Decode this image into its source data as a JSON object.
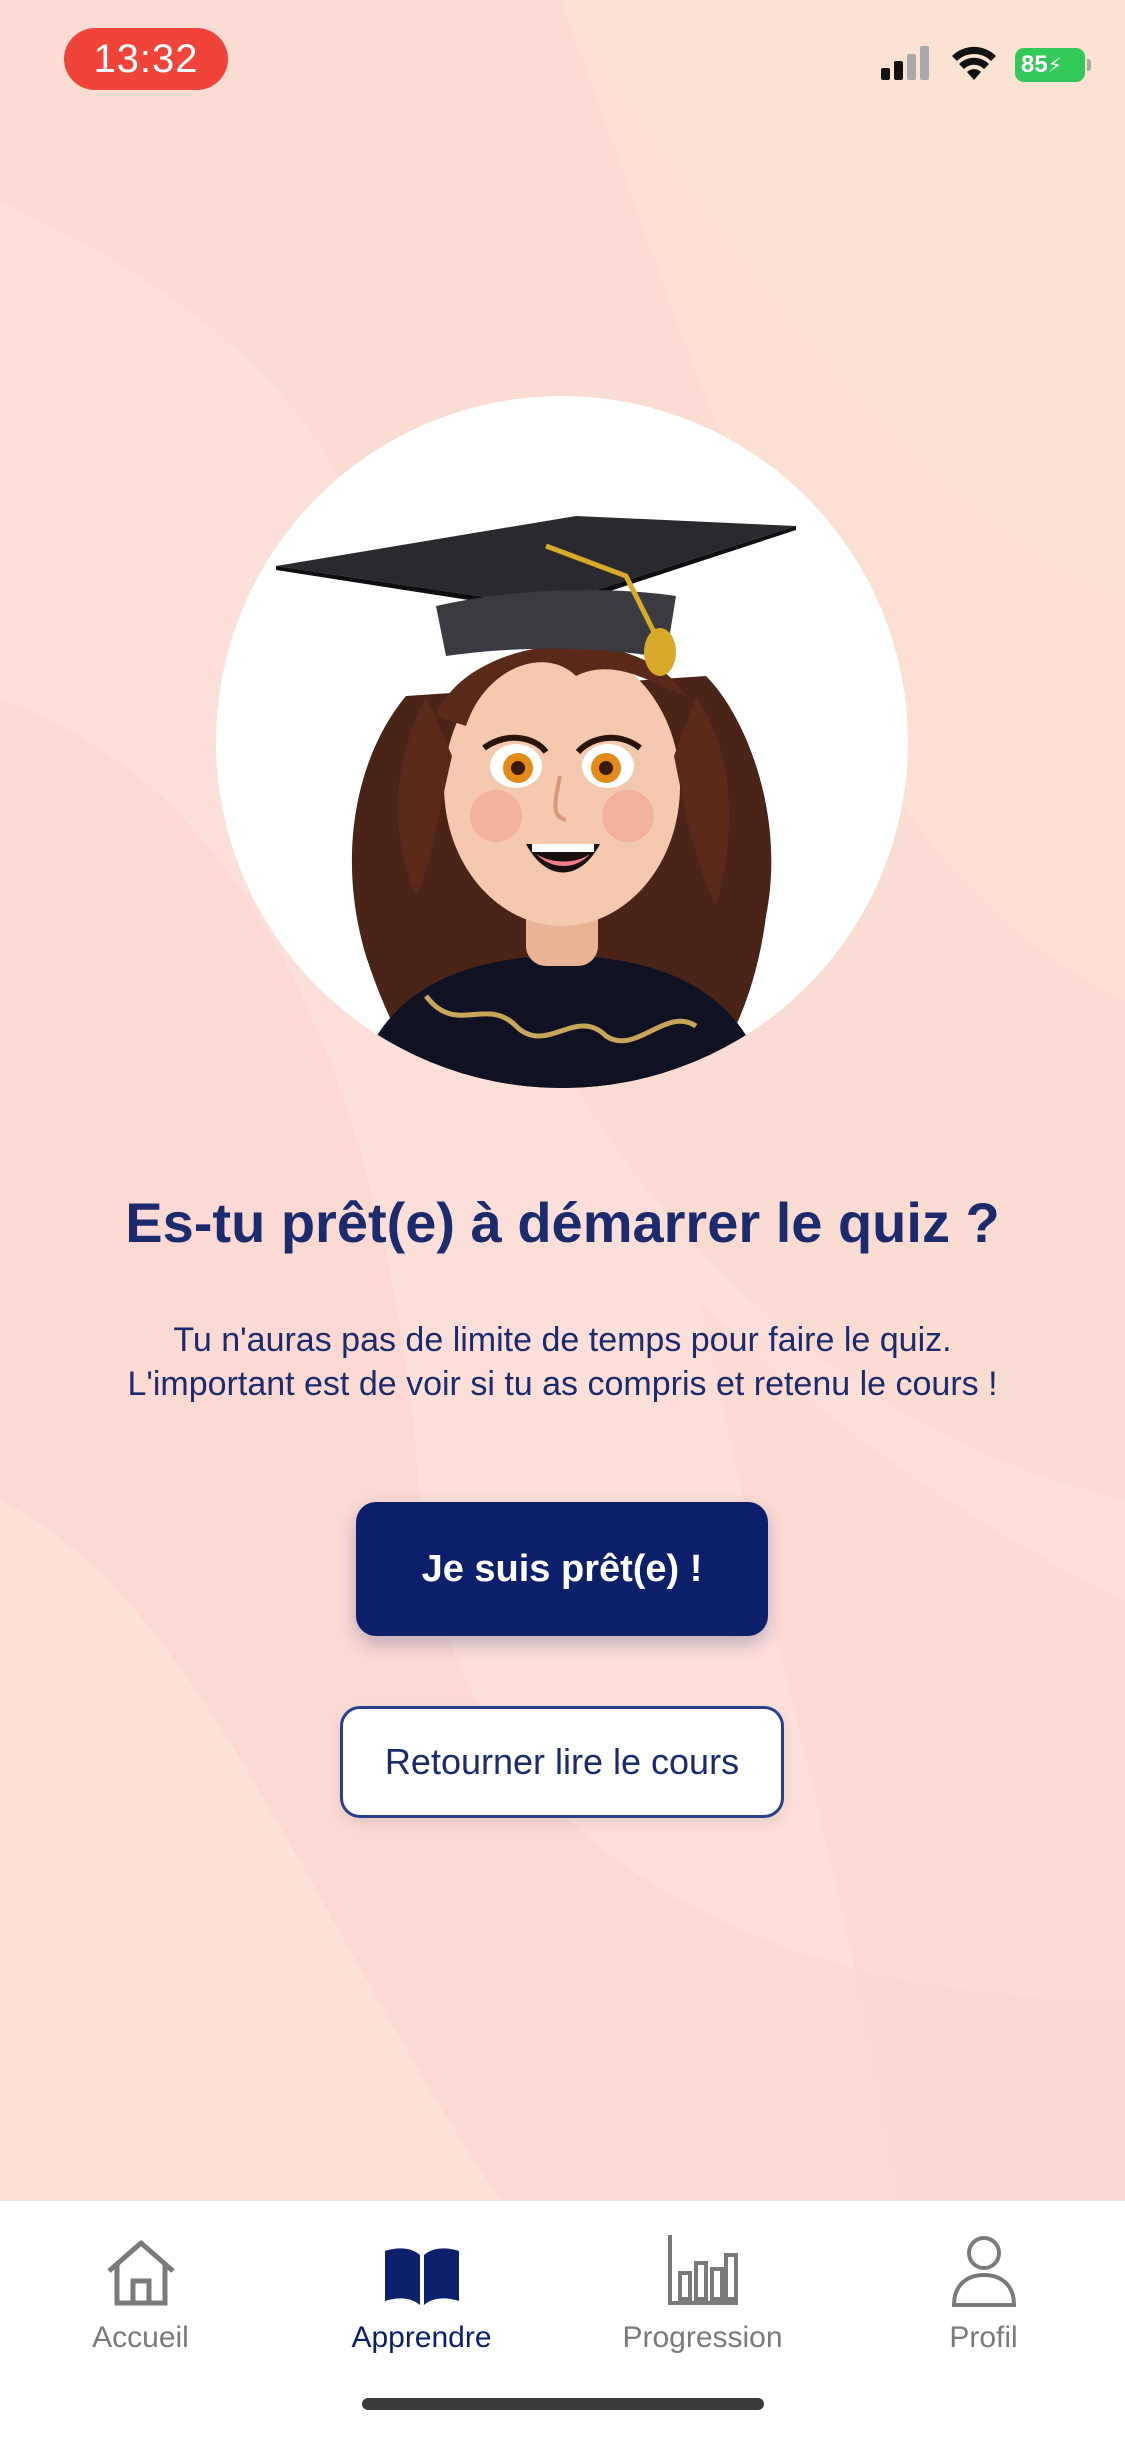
{
  "status_bar": {
    "time": "13:32",
    "battery": "85",
    "signal_icon": "cellular-signal-icon",
    "wifi_icon": "wifi-icon",
    "battery_icon": "battery-charging-icon"
  },
  "illustration": {
    "icon": "graduate-avatar-illustration"
  },
  "quiz_intro": {
    "title": "Es-tu prêt(e) à démarrer le quiz ?",
    "line1": "Tu n'auras pas de limite de temps pour faire le quiz.",
    "line2": "L'important est de voir si tu as compris et retenu le cours !",
    "primary_button": "Je suis prêt(e) !",
    "secondary_button": "Retourner lire le cours"
  },
  "tab_bar": {
    "active": "Apprendre",
    "items": [
      {
        "label": "Accueil",
        "icon": "home-icon"
      },
      {
        "label": "Apprendre",
        "icon": "book-icon"
      },
      {
        "label": "Progression",
        "icon": "bar-chart-icon"
      },
      {
        "label": "Profil",
        "icon": "person-icon"
      }
    ]
  },
  "colors": {
    "primary": "#0c1f6b",
    "title": "#1c2a6e",
    "time_pill": "#f0443a",
    "battery": "#34c759",
    "background": "#fbe3dc"
  }
}
